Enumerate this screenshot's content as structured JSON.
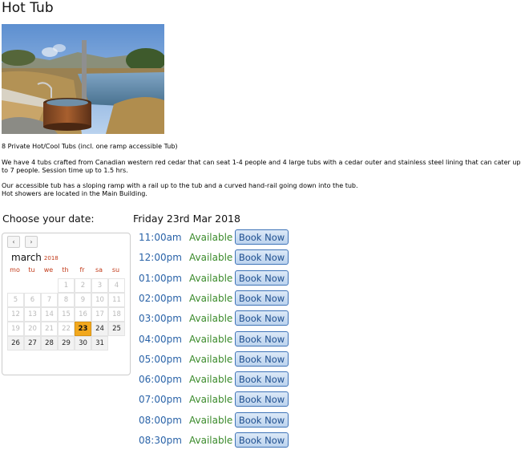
{
  "page": {
    "title": "Hot Tub",
    "desc1": "8 Private Hot/Cool Tubs (incl. one ramp accessible Tub)",
    "desc2a": "We have 4 tubs crafted from Canadian western red cedar that can seat 1-4 people and 4 large tubs with a cedar outer and stainless steel lining that can cater up",
    "desc2b": "to 7 people. Session time up to 1.5 hrs.",
    "desc3a": "Our accessible tub has a sloping ramp with a rail up to the tub and a curved hand-rail going down into the tub.",
    "desc3b": "Hot showers are located in the Main Building."
  },
  "booking": {
    "choose_label": "Choose your date:",
    "selected_date": "Friday 23rd Mar 2018"
  },
  "calendar": {
    "prev": "‹",
    "next": "›",
    "month": "march",
    "year": "2018",
    "dow": [
      "mo",
      "tu",
      "we",
      "th",
      "fr",
      "sa",
      "su"
    ],
    "weeks": [
      [
        "",
        "",
        "",
        "1",
        "2",
        "3",
        "4"
      ],
      [
        "5",
        "6",
        "7",
        "8",
        "9",
        "10",
        "11"
      ],
      [
        "12",
        "13",
        "14",
        "15",
        "16",
        "17",
        "18"
      ],
      [
        "19",
        "20",
        "21",
        "22",
        "23",
        "24",
        "25"
      ],
      [
        "26",
        "27",
        "28",
        "29",
        "30",
        "31",
        ""
      ]
    ],
    "selected": "23",
    "available": [
      "23",
      "24",
      "25",
      "26",
      "27",
      "28",
      "29",
      "30",
      "31"
    ]
  },
  "slots": [
    {
      "time": "11:00am",
      "status": "Available",
      "button": "Book Now"
    },
    {
      "time": "12:00pm",
      "status": "Available",
      "button": "Book Now"
    },
    {
      "time": "01:00pm",
      "status": "Available",
      "button": "Book Now"
    },
    {
      "time": "02:00pm",
      "status": "Available",
      "button": "Book Now"
    },
    {
      "time": "03:00pm",
      "status": "Available",
      "button": "Book Now"
    },
    {
      "time": "04:00pm",
      "status": "Available",
      "button": "Book Now"
    },
    {
      "time": "05:00pm",
      "status": "Available",
      "button": "Book Now"
    },
    {
      "time": "06:00pm",
      "status": "Available",
      "button": "Book Now"
    },
    {
      "time": "07:00pm",
      "status": "Available",
      "button": "Book Now"
    },
    {
      "time": "08:00pm",
      "status": "Available",
      "button": "Book Now"
    },
    {
      "time": "08:30pm",
      "status": "Available",
      "button": "Book Now"
    }
  ],
  "colors": {
    "time": "#2a63a8",
    "status": "#3a8a2a",
    "selected_day": "#f2a81d",
    "weekday_header": "#c23b1a"
  }
}
